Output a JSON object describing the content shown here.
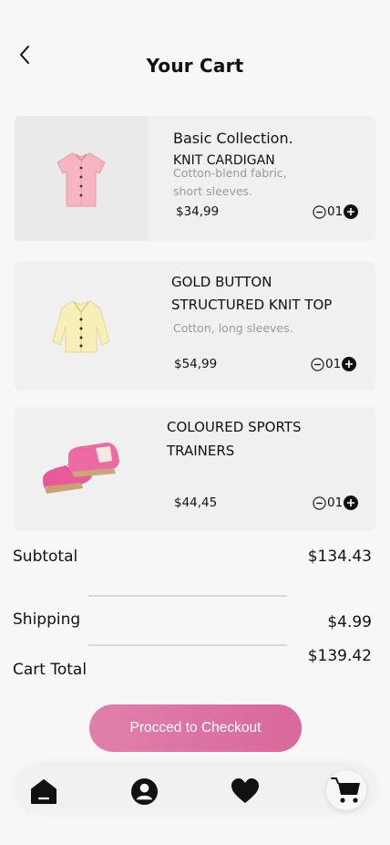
{
  "header": {
    "title": "Your Cart",
    "back_icon": "chevron-left-icon"
  },
  "cart_items": [
    {
      "name": "Basic Collection.",
      "subtitle": "KNIT CARDIGAN",
      "description": "Cotton-blend fabric, short sleeves.",
      "price": "$34,99",
      "quantity": "01",
      "image": "pink-shirt-image"
    },
    {
      "name": "GOLD BUTTON STRUCTURED KNIT TOP",
      "description": "Cotton, long sleeves.",
      "price": "$54,99",
      "quantity": "01",
      "image": "yellow-cardigan-image"
    },
    {
      "name": "COLOURED SPORTS TRAINERS",
      "price": "$44,45",
      "quantity": "01",
      "image": "pink-sneakers-image"
    }
  ],
  "summary": {
    "subtotal_label": "Subtotal",
    "subtotal_value": "$134.43",
    "shipping_label": "Shipping",
    "shipping_value": "$4.99",
    "total_label": "Cart Total",
    "total_value": "$139.42"
  },
  "checkout": {
    "label": "Procced to Checkout"
  },
  "bottom_nav": [
    "home-icon",
    "profile-icon",
    "heart-icon",
    "cart-icon"
  ],
  "colors": {
    "accent": "#dc75a3",
    "card_bg": "#f0f0f0",
    "page_bg": "#f7f7f7"
  }
}
